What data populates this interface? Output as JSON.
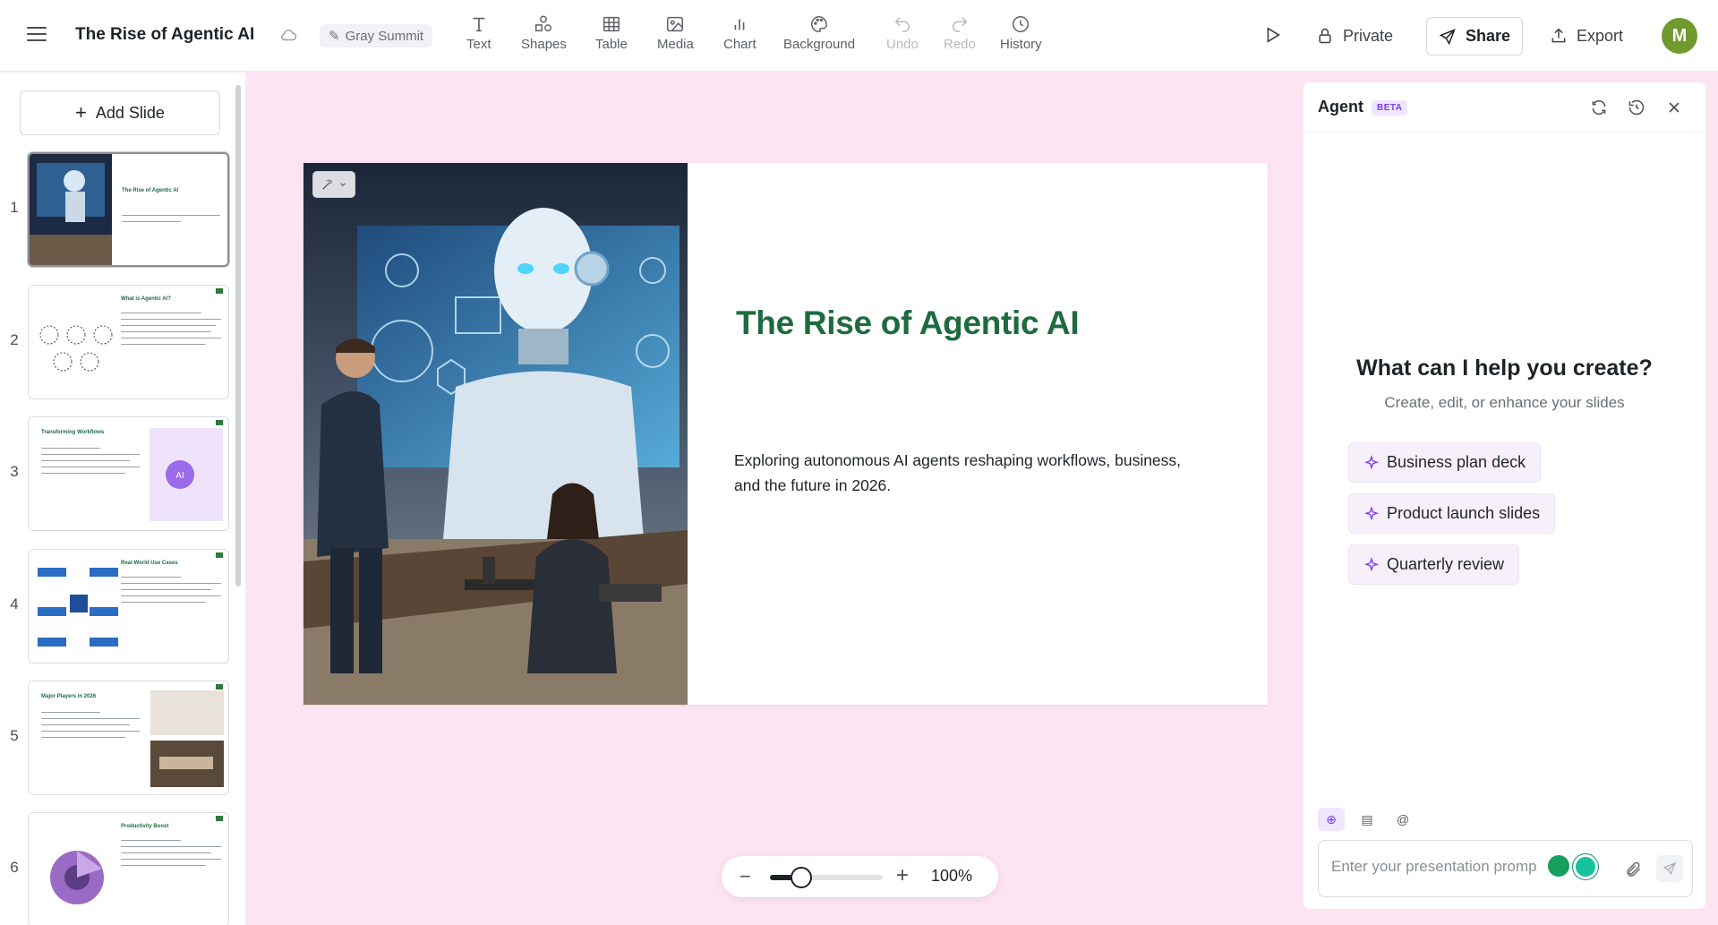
{
  "app": {
    "doc_title": "The Rise of Agentic AI",
    "theme_name": "Gray Summit"
  },
  "toolbar": {
    "tools": [
      {
        "label": "Text",
        "icon": "text-icon",
        "enabled": true
      },
      {
        "label": "Shapes",
        "icon": "shapes-icon",
        "enabled": true
      },
      {
        "label": "Table",
        "icon": "table-icon",
        "enabled": true
      },
      {
        "label": "Media",
        "icon": "media-icon",
        "enabled": true
      },
      {
        "label": "Chart",
        "icon": "chart-icon",
        "enabled": true
      },
      {
        "label": "Background",
        "icon": "palette-icon",
        "enabled": true
      },
      {
        "label": "Undo",
        "icon": "undo-icon",
        "enabled": false
      },
      {
        "label": "Redo",
        "icon": "redo-icon",
        "enabled": false
      },
      {
        "label": "History",
        "icon": "clock-icon",
        "enabled": true
      }
    ],
    "private_label": "Private",
    "share_label": "Share",
    "export_label": "Export",
    "avatar_initial": "M",
    "avatar_color": "#6f9a2d"
  },
  "sidebar": {
    "add_slide_label": "Add Slide",
    "slides": [
      {
        "number": "1",
        "title": "The Rise of Agentic AI",
        "active": true
      },
      {
        "number": "2",
        "title": "What is Agentic AI?",
        "active": false
      },
      {
        "number": "3",
        "title": "Transforming Workflows",
        "active": false
      },
      {
        "number": "4",
        "title": "Real-World Use Cases",
        "active": false
      },
      {
        "number": "5",
        "title": "Major Players in 2026",
        "active": false
      },
      {
        "number": "6",
        "title": "Productivity Boost",
        "active": false
      }
    ]
  },
  "slide": {
    "title": "The Rise of Agentic AI",
    "subtitle": "Exploring autonomous AI agents reshaping workflows, business, and the future in 2026.",
    "title_color": "#1d6b3f"
  },
  "zoom": {
    "value_label": "100%",
    "level_fraction": 0.28
  },
  "agent": {
    "title": "Agent",
    "badge": "BETA",
    "heading": "What can I help you create?",
    "subheading": "Create, edit, or enhance your slides",
    "suggestions": [
      "Business plan deck",
      "Product launch slides",
      "Quarterly review"
    ],
    "input_placeholder": "Enter your presentation prompt",
    "accent_color": "#7c3aed"
  }
}
